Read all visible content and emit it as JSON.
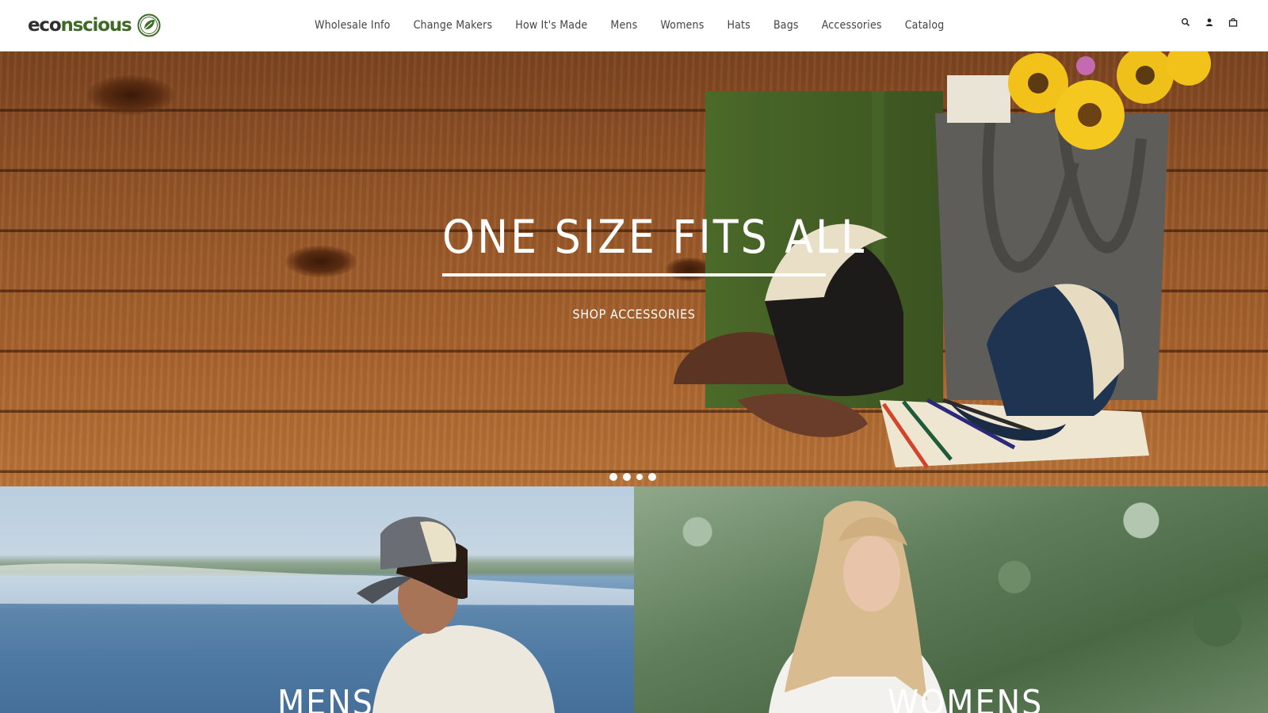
{
  "brand": {
    "name_part1": "eco",
    "name_part2": "nscious",
    "logo_icon": "leaf-circle-icon",
    "colors": {
      "accent": "#3d6b25",
      "text": "#2f2f2f"
    }
  },
  "nav": {
    "items": [
      {
        "label": "Wholesale Info"
      },
      {
        "label": "Change Makers"
      },
      {
        "label": "How It's Made"
      },
      {
        "label": "Mens"
      },
      {
        "label": "Womens"
      },
      {
        "label": "Hats"
      },
      {
        "label": "Bags"
      },
      {
        "label": "Accessories"
      },
      {
        "label": "Catalog"
      }
    ]
  },
  "header_icons": [
    "search-icon",
    "account-icon",
    "cart-icon"
  ],
  "hero": {
    "title": "ONE SIZE FITS ALL",
    "cta": "SHOP ACCESSORIES",
    "slides_count": 4,
    "active_slide": 3
  },
  "tiles": {
    "mens": {
      "label": "MENS"
    },
    "womens": {
      "label": "WOMENS"
    }
  }
}
